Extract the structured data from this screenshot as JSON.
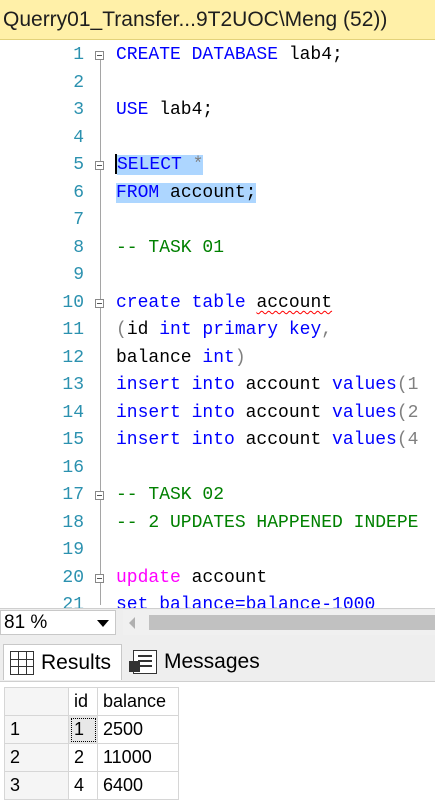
{
  "tab": {
    "title": "Querry01_Transfer...9T2UOC\\Meng (52))"
  },
  "editor": {
    "line_numbers": [
      "1",
      "2",
      "3",
      "4",
      "5",
      "6",
      "7",
      "8",
      "9",
      "10",
      "11",
      "12",
      "13",
      "14",
      "15",
      "16",
      "17",
      "18",
      "19",
      "20",
      "21"
    ],
    "lines": {
      "l1_kw": "CREATE DATABASE",
      "l1_rest": " lab4;",
      "l3_kw": "USE",
      "l3_rest": " lab4;",
      "l5_kw": "SELECT",
      "l5_rest": " *",
      "l6_kw": "FROM",
      "l6_rest": " account;",
      "l8": "-- TASK 01",
      "l10_kw": "create table",
      "l10_name": "account",
      "l11_p": "(",
      "l11_a": "id ",
      "l11_kw": "int primary key",
      "l11_c": ",",
      "l12_a": "balance ",
      "l12_kw": "int",
      "l12_p": ")",
      "l13_kw": "insert into",
      "l13_a": " account ",
      "l13_kw2": "values",
      "l13_p": "(1",
      "l14_kw": "insert into",
      "l14_a": " account ",
      "l14_kw2": "values",
      "l14_p": "(2",
      "l15_kw": "insert into",
      "l15_a": " account ",
      "l15_kw2": "values",
      "l15_p": "(4",
      "l17": "-- TASK 02",
      "l18": "-- 2 UPDATES HAPPENED INDEPE",
      "l20_fn": "update",
      "l20_rest": " account",
      "l21": "set balance=balance-1000"
    }
  },
  "status": {
    "zoom": "81 %"
  },
  "results_tabs": {
    "results": "Results",
    "messages": "Messages"
  },
  "grid": {
    "columns": [
      "id",
      "balance"
    ],
    "rows": [
      {
        "n": "1",
        "id": "1",
        "balance": "2500"
      },
      {
        "n": "2",
        "id": "2",
        "balance": "11000"
      },
      {
        "n": "3",
        "id": "4",
        "balance": "6400"
      }
    ]
  },
  "colors": {
    "tab_bg": "#fff0a8",
    "keyword": "#0000ff",
    "comment": "#008000",
    "function": "#ff00ff",
    "selection": "#add6ff",
    "line_number": "#2b91af"
  }
}
